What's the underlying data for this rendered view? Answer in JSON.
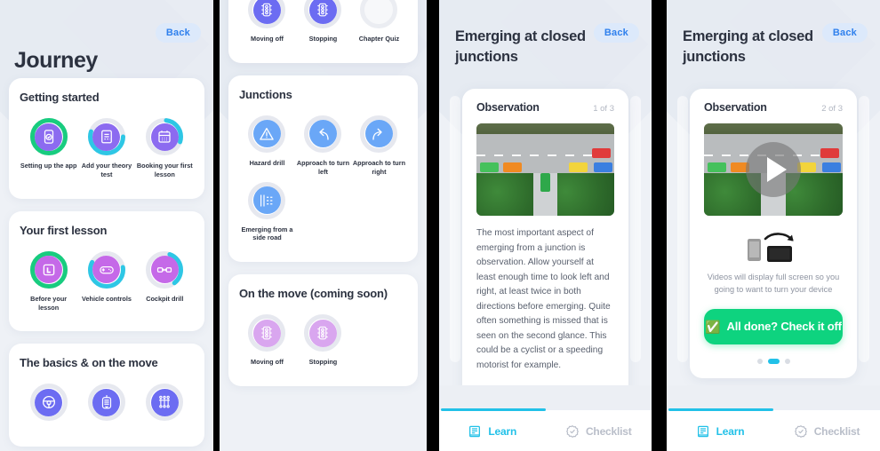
{
  "panels": {
    "journey": {
      "back_label": "Back",
      "title": "Journey",
      "sections": [
        {
          "title": "Getting started",
          "tiles": [
            {
              "label": "Setting up the app",
              "icon": "phone-check-icon",
              "progress": 100,
              "color": "#8c6bf0",
              "ring": "#18cc7f"
            },
            {
              "label": "Add your theory test",
              "icon": "document-lines-icon",
              "progress": 55,
              "color": "#8c6bf0",
              "ring": "#2ec7e5"
            },
            {
              "label": "Booking your first lesson",
              "icon": "calendar-icon",
              "progress": 28,
              "color": "#8c6bf0",
              "ring": "#2ec7e5"
            }
          ]
        },
        {
          "title": "Your first lesson",
          "tiles": [
            {
              "label": "Before your lesson",
              "icon": "l-plate-icon",
              "progress": 100,
              "color": "#c569e8",
              "ring": "#18cc7f"
            },
            {
              "label": "Vehicle controls",
              "icon": "gamepad-icon",
              "progress": 60,
              "color": "#c569e8",
              "ring": "#2ec7e5"
            },
            {
              "label": "Cockpit drill",
              "icon": "mirrors-icon",
              "progress": 35,
              "color": "#c569e8",
              "ring": "#2ec7e5"
            }
          ]
        },
        {
          "title": "The basics & on the move",
          "tiles": [
            {
              "label": "",
              "icon": "steering-wheel-icon",
              "progress": 0,
              "color": "#6c6cf2",
              "ring": "#e6e8ef"
            },
            {
              "label": "",
              "icon": "handbrake-icon",
              "progress": 0,
              "color": "#6c6cf2",
              "ring": "#e6e8ef"
            },
            {
              "label": "",
              "icon": "gearstick-icon",
              "progress": 0,
              "color": "#6c6cf2",
              "ring": "#e6e8ef"
            }
          ]
        }
      ]
    },
    "journey_scrolled": {
      "sections": [
        {
          "title": "",
          "tiles": [
            {
              "label": "Moving off",
              "icon": "traffic-light-icon",
              "progress": 0,
              "color": "#6c6cf2",
              "ring": "#e6e8ef"
            },
            {
              "label": "Stopping",
              "icon": "traffic-light-icon",
              "progress": 0,
              "color": "#6c6cf2",
              "ring": "#e6e8ef"
            },
            {
              "label": "Chapter Quiz",
              "icon": "empty-circle-icon",
              "progress": 0,
              "color": "",
              "ring": "#ebedf2"
            }
          ]
        },
        {
          "title": "Junctions",
          "tiles": [
            {
              "label": "Hazard drill",
              "icon": "warning-triangle-icon",
              "progress": 0,
              "color": "#6aa7f7",
              "ring": "#e6e8ef"
            },
            {
              "label": "Approach to turn left",
              "icon": "arrow-turn-left-icon",
              "progress": 0,
              "color": "#6aa7f7",
              "ring": "#e6e8ef"
            },
            {
              "label": "Approach to turn right",
              "icon": "arrow-turn-right-icon",
              "progress": 0,
              "color": "#6aa7f7",
              "ring": "#e6e8ef"
            },
            {
              "label": "Emerging from a side road",
              "icon": "side-road-icon",
              "progress": 0,
              "color": "#6aa7f7",
              "ring": "#e6e8ef"
            }
          ]
        },
        {
          "title": "On the move (coming soon)",
          "tiles": [
            {
              "label": "Moving off",
              "icon": "traffic-light-icon",
              "progress": 0,
              "color": "#d9a6ef",
              "ring": "#e6e8ef"
            },
            {
              "label": "Stopping",
              "icon": "traffic-light-icon",
              "progress": 0,
              "color": "#d9a6ef",
              "ring": "#e6e8ef"
            }
          ]
        }
      ]
    },
    "lesson_slide1": {
      "back_label": "Back",
      "title": "Emerging at closed junctions",
      "card_title": "Observation",
      "counter": "1 of 3",
      "body": "The most important aspect of emerging from a junction is observation. Allow yourself at least enough time to look left and right, at least twice in both directions before emerging. Quite often something is missed that is seen on the second glance. This could be a cyclist or a speeding motorist for example.",
      "active_dot": 0,
      "dot_count": 3,
      "tabs": [
        {
          "label": "Learn",
          "icon": "book-icon",
          "active": true
        },
        {
          "label": "Checklist",
          "icon": "check-badge-icon",
          "active": false
        }
      ]
    },
    "lesson_slide2": {
      "back_label": "Back",
      "title": "Emerging at closed junctions",
      "card_title": "Observation",
      "counter": "2 of 3",
      "rotate_note": "Videos will display full screen so you going to want to turn your device",
      "cta_label": "All done? Check it off",
      "cta_icon": "green-check-box-icon",
      "active_dot": 1,
      "dot_count": 3,
      "tabs": [
        {
          "label": "Learn",
          "icon": "book-icon",
          "active": true
        },
        {
          "label": "Checklist",
          "icon": "check-badge-icon",
          "active": false
        }
      ]
    }
  },
  "colors": {
    "accent_cyan": "#22c1e8",
    "accent_green": "#0ed37f",
    "back_text": "#2f80ed",
    "back_bg": "#dce9fb",
    "text_dark": "#2c3240",
    "text_muted": "#8e94a1",
    "page_bg": "#eef1f6"
  }
}
